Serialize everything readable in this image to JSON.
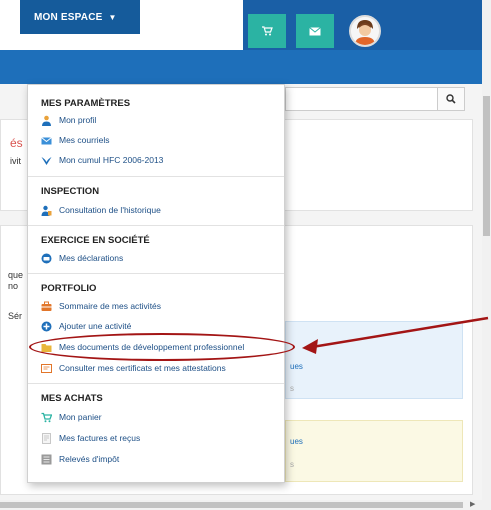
{
  "nav": {
    "mon_espace": "MON ESPACE"
  },
  "menu": {
    "sections": [
      {
        "title": "MES PARAMÈTRES",
        "items": [
          {
            "label": "Mon profil",
            "icon": "person-icon"
          },
          {
            "label": "Mes courriels",
            "icon": "mail-icon"
          },
          {
            "label": "Mon cumul HFC 2006-2013",
            "icon": "bird-icon"
          }
        ]
      },
      {
        "title": "INSPECTION",
        "items": [
          {
            "label": "Consultation de l'historique",
            "icon": "user-history-icon"
          }
        ]
      },
      {
        "title": "EXERCICE EN SOCIÉTÉ",
        "items": [
          {
            "label": "Mes déclarations",
            "icon": "declaration-icon"
          }
        ]
      },
      {
        "title": "PORTFOLIO",
        "items": [
          {
            "label": "Sommaire de mes activités",
            "icon": "briefcase-icon"
          },
          {
            "label": "Ajouter une activité",
            "icon": "add-circle-icon"
          },
          {
            "label": "Mes documents de développement professionnel",
            "icon": "folder-icon"
          },
          {
            "label": "Consulter mes certificats et mes attestations",
            "icon": "certificate-icon"
          }
        ]
      },
      {
        "title": "MES ACHATS",
        "items": [
          {
            "label": "Mon panier",
            "icon": "cart-icon"
          },
          {
            "label": "Mes factures et reçus",
            "icon": "invoice-icon"
          },
          {
            "label": "Relevés d'impôt",
            "icon": "tax-icon"
          }
        ]
      }
    ]
  },
  "background": {
    "fragments": [
      "és",
      "ivit",
      "que",
      "no",
      "Sér"
    ],
    "card_fragments": [
      "ues",
      "s",
      "ues",
      "s"
    ]
  },
  "colors": {
    "topbar_blue": "#1a5fa6",
    "navbar_blue": "#1e6fba",
    "teal": "#2bb3a3",
    "link_blue": "#1d4f86",
    "annotation_red": "#a31515"
  }
}
